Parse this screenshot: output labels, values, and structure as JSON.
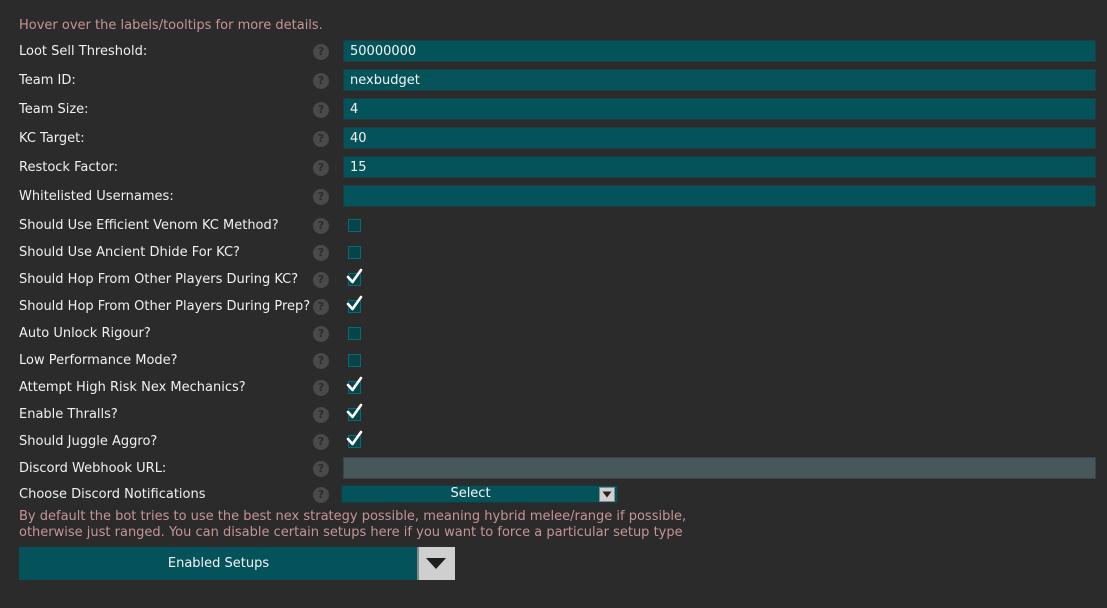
{
  "hint": "Hover over the labels/tooltips for more details.",
  "help_glyph": "?",
  "fields": [
    {
      "label": "Loot Sell Threshold:",
      "value": "50000000"
    },
    {
      "label": "Team ID:",
      "value": "nexbudget"
    },
    {
      "label": "Team Size:",
      "value": "4"
    },
    {
      "label": "KC Target:",
      "value": "40"
    },
    {
      "label": "Restock Factor:",
      "value": "15"
    },
    {
      "label": "Whitelisted Usernames:",
      "value": ""
    }
  ],
  "toggles": [
    {
      "label": "Should Use Efficient Venom KC Method?",
      "checked": false
    },
    {
      "label": "Should Use Ancient Dhide For KC?",
      "checked": false
    },
    {
      "label": "Should Hop From Other Players During KC?",
      "checked": true
    },
    {
      "label": "Should Hop From Other Players During Prep?",
      "checked": true
    },
    {
      "label": "Auto Unlock Rigour?",
      "checked": false
    },
    {
      "label": "Low Performance Mode?",
      "checked": false
    },
    {
      "label": "Attempt High Risk Nex Mechanics?",
      "checked": true
    },
    {
      "label": "Enable Thralls?",
      "checked": true
    },
    {
      "label": "Should Juggle Aggro?",
      "checked": true
    }
  ],
  "webhook": {
    "label": "Discord Webhook URL:",
    "value": ""
  },
  "notifications": {
    "label": "Choose Discord Notifications",
    "selected": "Select"
  },
  "note_line1": "By default the bot tries to use the best nex strategy possible, meaning hybrid melee/range if possible,",
  "note_line2": "otherwise just ranged. You can disable certain setups here if you want to force a particular setup type",
  "setups_button": "Enabled Setups",
  "colors": {
    "accent": "#05535a",
    "hint": "#c79494",
    "background": "#2b2b2b"
  }
}
